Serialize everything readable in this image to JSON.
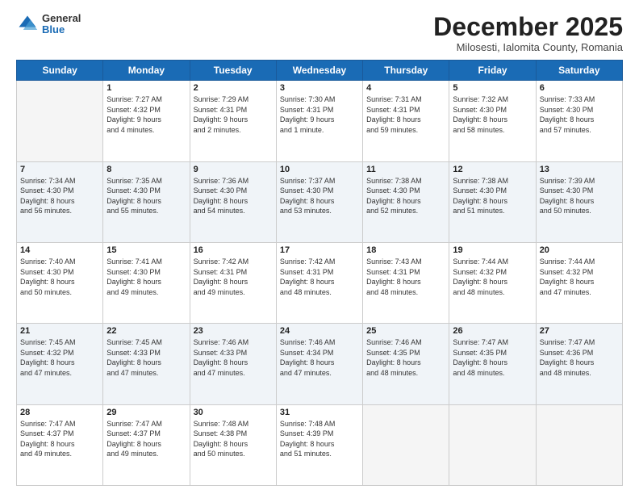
{
  "logo": {
    "general": "General",
    "blue": "Blue"
  },
  "title": "December 2025",
  "location": "Milosesti, Ialomita County, Romania",
  "days_header": [
    "Sunday",
    "Monday",
    "Tuesday",
    "Wednesday",
    "Thursday",
    "Friday",
    "Saturday"
  ],
  "weeks": [
    [
      {
        "day": "",
        "info": ""
      },
      {
        "day": "1",
        "info": "Sunrise: 7:27 AM\nSunset: 4:32 PM\nDaylight: 9 hours\nand 4 minutes."
      },
      {
        "day": "2",
        "info": "Sunrise: 7:29 AM\nSunset: 4:31 PM\nDaylight: 9 hours\nand 2 minutes."
      },
      {
        "day": "3",
        "info": "Sunrise: 7:30 AM\nSunset: 4:31 PM\nDaylight: 9 hours\nand 1 minute."
      },
      {
        "day": "4",
        "info": "Sunrise: 7:31 AM\nSunset: 4:31 PM\nDaylight: 8 hours\nand 59 minutes."
      },
      {
        "day": "5",
        "info": "Sunrise: 7:32 AM\nSunset: 4:30 PM\nDaylight: 8 hours\nand 58 minutes."
      },
      {
        "day": "6",
        "info": "Sunrise: 7:33 AM\nSunset: 4:30 PM\nDaylight: 8 hours\nand 57 minutes."
      }
    ],
    [
      {
        "day": "7",
        "info": "Sunrise: 7:34 AM\nSunset: 4:30 PM\nDaylight: 8 hours\nand 56 minutes."
      },
      {
        "day": "8",
        "info": "Sunrise: 7:35 AM\nSunset: 4:30 PM\nDaylight: 8 hours\nand 55 minutes."
      },
      {
        "day": "9",
        "info": "Sunrise: 7:36 AM\nSunset: 4:30 PM\nDaylight: 8 hours\nand 54 minutes."
      },
      {
        "day": "10",
        "info": "Sunrise: 7:37 AM\nSunset: 4:30 PM\nDaylight: 8 hours\nand 53 minutes."
      },
      {
        "day": "11",
        "info": "Sunrise: 7:38 AM\nSunset: 4:30 PM\nDaylight: 8 hours\nand 52 minutes."
      },
      {
        "day": "12",
        "info": "Sunrise: 7:38 AM\nSunset: 4:30 PM\nDaylight: 8 hours\nand 51 minutes."
      },
      {
        "day": "13",
        "info": "Sunrise: 7:39 AM\nSunset: 4:30 PM\nDaylight: 8 hours\nand 50 minutes."
      }
    ],
    [
      {
        "day": "14",
        "info": "Sunrise: 7:40 AM\nSunset: 4:30 PM\nDaylight: 8 hours\nand 50 minutes."
      },
      {
        "day": "15",
        "info": "Sunrise: 7:41 AM\nSunset: 4:30 PM\nDaylight: 8 hours\nand 49 minutes."
      },
      {
        "day": "16",
        "info": "Sunrise: 7:42 AM\nSunset: 4:31 PM\nDaylight: 8 hours\nand 49 minutes."
      },
      {
        "day": "17",
        "info": "Sunrise: 7:42 AM\nSunset: 4:31 PM\nDaylight: 8 hours\nand 48 minutes."
      },
      {
        "day": "18",
        "info": "Sunrise: 7:43 AM\nSunset: 4:31 PM\nDaylight: 8 hours\nand 48 minutes."
      },
      {
        "day": "19",
        "info": "Sunrise: 7:44 AM\nSunset: 4:32 PM\nDaylight: 8 hours\nand 48 minutes."
      },
      {
        "day": "20",
        "info": "Sunrise: 7:44 AM\nSunset: 4:32 PM\nDaylight: 8 hours\nand 47 minutes."
      }
    ],
    [
      {
        "day": "21",
        "info": "Sunrise: 7:45 AM\nSunset: 4:32 PM\nDaylight: 8 hours\nand 47 minutes."
      },
      {
        "day": "22",
        "info": "Sunrise: 7:45 AM\nSunset: 4:33 PM\nDaylight: 8 hours\nand 47 minutes."
      },
      {
        "day": "23",
        "info": "Sunrise: 7:46 AM\nSunset: 4:33 PM\nDaylight: 8 hours\nand 47 minutes."
      },
      {
        "day": "24",
        "info": "Sunrise: 7:46 AM\nSunset: 4:34 PM\nDaylight: 8 hours\nand 47 minutes."
      },
      {
        "day": "25",
        "info": "Sunrise: 7:46 AM\nSunset: 4:35 PM\nDaylight: 8 hours\nand 48 minutes."
      },
      {
        "day": "26",
        "info": "Sunrise: 7:47 AM\nSunset: 4:35 PM\nDaylight: 8 hours\nand 48 minutes."
      },
      {
        "day": "27",
        "info": "Sunrise: 7:47 AM\nSunset: 4:36 PM\nDaylight: 8 hours\nand 48 minutes."
      }
    ],
    [
      {
        "day": "28",
        "info": "Sunrise: 7:47 AM\nSunset: 4:37 PM\nDaylight: 8 hours\nand 49 minutes."
      },
      {
        "day": "29",
        "info": "Sunrise: 7:47 AM\nSunset: 4:37 PM\nDaylight: 8 hours\nand 49 minutes."
      },
      {
        "day": "30",
        "info": "Sunrise: 7:48 AM\nSunset: 4:38 PM\nDaylight: 8 hours\nand 50 minutes."
      },
      {
        "day": "31",
        "info": "Sunrise: 7:48 AM\nSunset: 4:39 PM\nDaylight: 8 hours\nand 51 minutes."
      },
      {
        "day": "",
        "info": ""
      },
      {
        "day": "",
        "info": ""
      },
      {
        "day": "",
        "info": ""
      }
    ]
  ]
}
